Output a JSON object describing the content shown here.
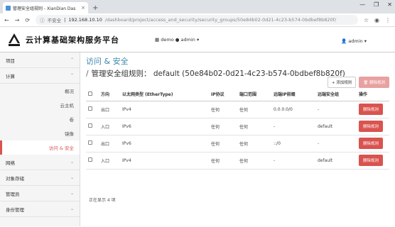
{
  "browser": {
    "tab_title": "管理安全组规则 - XianDian Das",
    "tab_close": "×",
    "new_tab": "+",
    "win_min": "—",
    "win_max": "❐",
    "win_close": "✕",
    "insecure": "不安全",
    "host": "192.168.10.10",
    "path": "/dashboard/project/access_and_security/security_groups/50e84b02-0d21-4c23-b574-0bdbef8b820f/"
  },
  "header": {
    "brand": "云计算基础架构服务平台",
    "project": "demo",
    "project_user": "admin",
    "user": "admin"
  },
  "sidebar": {
    "sections": [
      {
        "label": "项目"
      },
      {
        "label": "计算"
      }
    ],
    "items": [
      {
        "label": "概况"
      },
      {
        "label": "云主机"
      },
      {
        "label": "卷"
      },
      {
        "label": "镜像"
      },
      {
        "label": "访问 & 安全"
      }
    ],
    "bottom_sections": [
      {
        "label": "网络"
      },
      {
        "label": "对象存储"
      },
      {
        "label": "管理员"
      },
      {
        "label": "身份管理"
      }
    ]
  },
  "main": {
    "breadcrumb": "访问 & 安全",
    "title": "管理安全组规则： default (50e84b02-0d21-4c23-b574-0bdbef8b820f)",
    "add_rule": "+ 添加规则",
    "delete_rules": "删除规则",
    "columns": [
      "方向",
      "以太网类型 (EtherType)",
      "IP协议",
      "端口范围",
      "远端IP前缀",
      "远端安全组",
      "操作"
    ],
    "rows": [
      {
        "direction": "出口",
        "ethertype": "IPv4",
        "protocol": "任何",
        "port": "任何",
        "prefix": "0.0.0.0/0",
        "group": "-",
        "action": "删除规则"
      },
      {
        "direction": "入口",
        "ethertype": "IPv6",
        "protocol": "任何",
        "port": "任何",
        "prefix": "-",
        "group": "default",
        "action": "删除规则"
      },
      {
        "direction": "出口",
        "ethertype": "IPv6",
        "protocol": "任何",
        "port": "任何",
        "prefix": "::/0",
        "group": "-",
        "action": "删除规则"
      },
      {
        "direction": "入口",
        "ethertype": "IPv4",
        "protocol": "任何",
        "port": "任何",
        "prefix": "-",
        "group": "default",
        "action": "删除规则"
      }
    ],
    "count_text": "正在显示 4 项"
  }
}
